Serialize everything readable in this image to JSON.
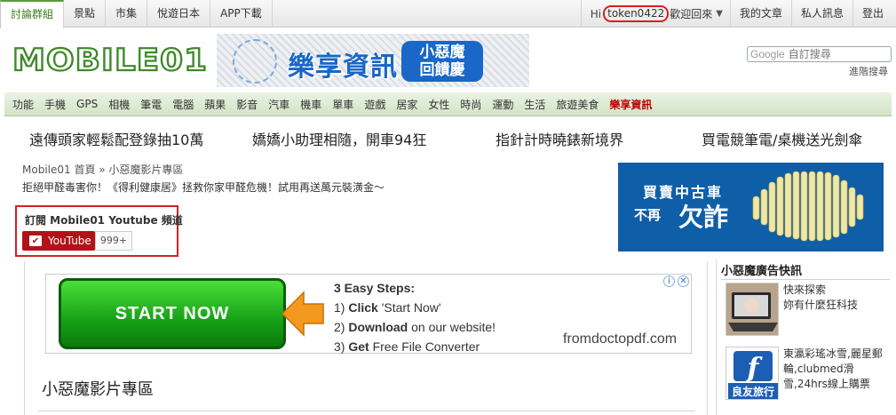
{
  "topnav": {
    "tabs": [
      "討論群組",
      "景點",
      "市集",
      "悅遊日本",
      "APP下載"
    ]
  },
  "userbar": {
    "hi": "Hi",
    "username": "token0422",
    "welcome": "歡迎回來",
    "links": [
      "我的文章",
      "私人訊息",
      "登出"
    ]
  },
  "header": {
    "logo_text": "MOBILE01",
    "banner_text_main": "樂享資訊",
    "banner_text_badge_1": "小惡魔",
    "banner_text_badge_2": "回饋慶",
    "search_google": "Google",
    "search_placeholder": "自訂搜尋",
    "advanced_search": "進階搜尋"
  },
  "categories": [
    "功能",
    "手機",
    "GPS",
    "相機",
    "筆電",
    "電腦",
    "蘋果",
    "影音",
    "汽車",
    "機車",
    "單車",
    "遊戲",
    "居家",
    "女性",
    "時尚",
    "運動",
    "生活",
    "旅遊美食",
    "樂享資訊"
  ],
  "promos": [
    "遠傳頭家輕鬆配登錄抽10萬",
    "嬌嬌小助理相隨，開車94狂",
    "指針計時曉錶新境界",
    "買電競筆電/桌機送光劍傘"
  ],
  "breadcrumb": "Mobile01 首頁 » 小惡魔影片專區",
  "subline": "拒絕甲醛毒害你！《得利健康居》拯救你家甲醛危機！試用再送萬元裝潢金～",
  "subscribe": {
    "title": "訂閱 Mobile01 Youtube 頻道",
    "button_label": "YouTube",
    "count": "999+"
  },
  "right_ad": {
    "line1": "買賣中古車",
    "line2": "不再",
    "line3": "欠詐"
  },
  "main_ad": {
    "button_label": "START NOW",
    "steps_title": "3 Easy Steps:",
    "steps": [
      {
        "num": "1)",
        "bold": "Click",
        "rest": " 'Start Now'"
      },
      {
        "num": "2)",
        "bold": "Download",
        "rest": " on our website!"
      },
      {
        "num": "3)",
        "bold": "Get",
        "rest": " Free File Converter"
      }
    ],
    "domain": "fromdoctopdf.com"
  },
  "section_title": "小惡魔影片專區",
  "sidebar": {
    "heading": "小惡魔廣告快訊",
    "items": [
      {
        "text": "快來探索\n妳有什麼狂科技"
      },
      {
        "text": "東瀛彩瑤冰雪,麗星郵輪,clubmed滑雪,24hrs線上購票"
      }
    ],
    "thumb2_label": "良友旅行"
  },
  "colors": {
    "accent_green": "#3a7d1e",
    "highlight_red": "#d62020",
    "youtube_red": "#b31217",
    "ad_blue": "#0f5ea8"
  }
}
